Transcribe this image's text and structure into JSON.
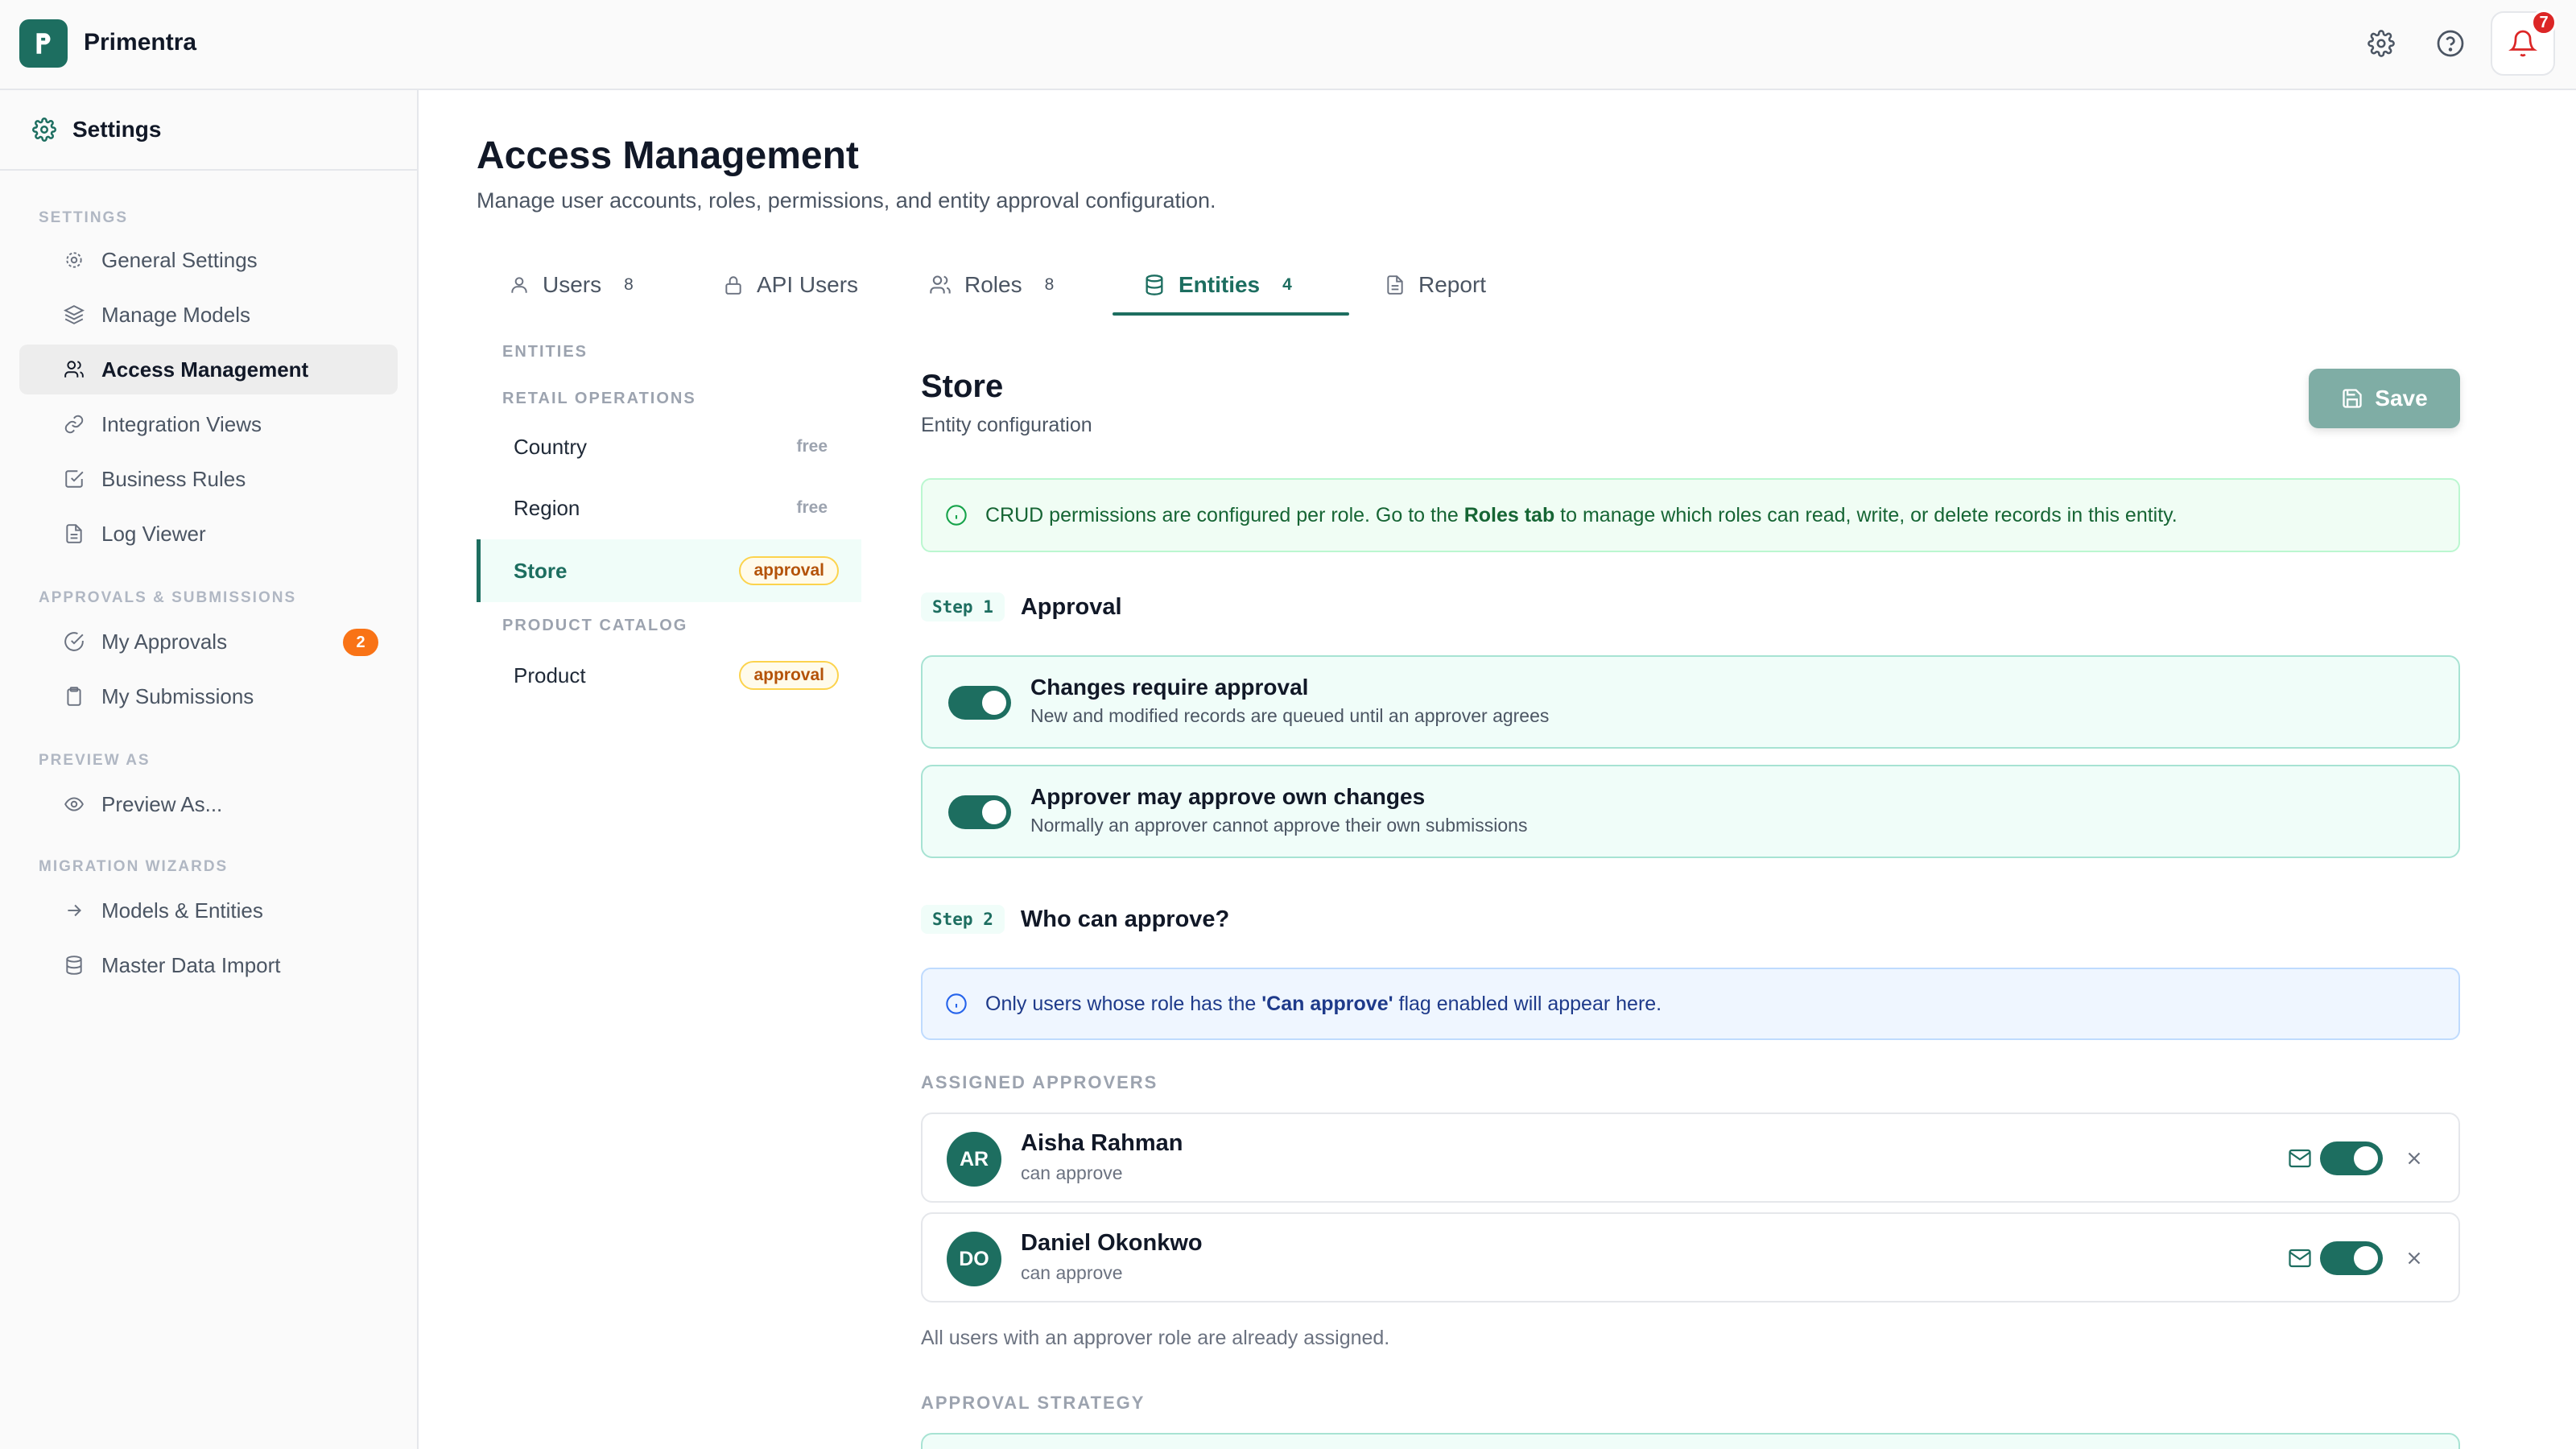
{
  "app": {
    "name": "Primentra",
    "notification_count": "7"
  },
  "sidebar": {
    "header": "Settings",
    "sections": {
      "settings": "SETTINGS",
      "approvals": "APPROVALS & SUBMISSIONS",
      "preview": "PREVIEW AS",
      "migration": "MIGRATION WIZARDS"
    },
    "items": [
      {
        "label": "General Settings",
        "icon": "gear-icon"
      },
      {
        "label": "Manage Models",
        "icon": "layers-icon"
      },
      {
        "label": "Access Management",
        "icon": "users-icon",
        "active": true
      },
      {
        "label": "Integration Views",
        "icon": "link-icon"
      },
      {
        "label": "Business Rules",
        "icon": "checkbox-icon"
      },
      {
        "label": "Log Viewer",
        "icon": "document-icon"
      },
      {
        "label": "My Approvals",
        "icon": "check-circle-icon",
        "badge": "2"
      },
      {
        "label": "My Submissions",
        "icon": "clipboard-icon"
      },
      {
        "label": "Preview As...",
        "icon": "eye-icon"
      },
      {
        "label": "Models & Entities",
        "icon": "arrow-right-icon"
      },
      {
        "label": "Master Data Import",
        "icon": "database-icon"
      }
    ]
  },
  "page": {
    "title": "Access Management",
    "subtitle": "Manage user accounts, roles, permissions, and entity approval configuration."
  },
  "tabs": [
    {
      "label": "Users",
      "count": "8"
    },
    {
      "label": "API Users",
      "count": ""
    },
    {
      "label": "Roles",
      "count": "8"
    },
    {
      "label": "Entities",
      "count": "4",
      "active": true
    },
    {
      "label": "Report",
      "count": ""
    }
  ],
  "entities": {
    "heading": "ENTITIES",
    "groups": [
      {
        "name": "RETAIL OPERATIONS",
        "items": [
          {
            "name": "Country",
            "tag": "free"
          },
          {
            "name": "Region",
            "tag": "free"
          },
          {
            "name": "Store",
            "tag": "approval",
            "active": true
          }
        ]
      },
      {
        "name": "PRODUCT CATALOG",
        "items": [
          {
            "name": "Product",
            "tag": "approval"
          }
        ]
      }
    ]
  },
  "detail": {
    "title": "Store",
    "subtitle": "Entity configuration",
    "save_label": "Save",
    "crud_banner": {
      "before": "CRUD permissions are configured per role. Go to the ",
      "link": "Roles tab",
      "after": " to manage which roles can read, write, or delete records in this entity."
    },
    "step1": {
      "chip": "Step 1",
      "label": "Approval"
    },
    "toggles": [
      {
        "title": "Changes require approval",
        "desc": "New and modified records are queued until an approver agrees",
        "on": true
      },
      {
        "title": "Approver may approve own changes",
        "desc": "Normally an approver cannot approve their own submissions",
        "on": true
      }
    ],
    "step2": {
      "chip": "Step 2",
      "label": "Who can approve?"
    },
    "approve_banner": {
      "before": "Only users whose role has the ",
      "link": "'Can approve'",
      "after": " flag enabled will appear here."
    },
    "assigned_label": "ASSIGNED APPROVERS",
    "approvers": [
      {
        "initials": "AR",
        "name": "Aisha Rahman",
        "role": "can approve",
        "notify": true
      },
      {
        "initials": "DO",
        "name": "Daniel Okonkwo",
        "role": "can approve",
        "notify": true
      }
    ],
    "note": "All users with an approver role are already assigned.",
    "strategy_label": "APPROVAL STRATEGY"
  },
  "colors": {
    "brand": "#1d6e60",
    "badge": "#f97316",
    "alert": "#dc2626"
  }
}
